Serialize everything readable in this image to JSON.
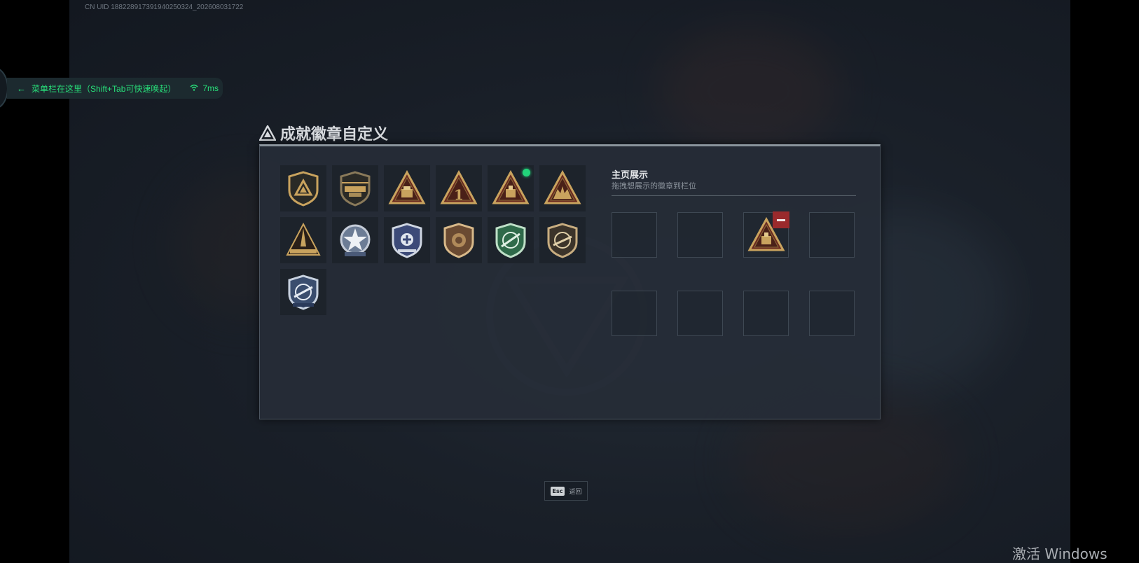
{
  "uid_text": "CN UID 1882289173919402503​24_202608031722",
  "menu_bar": {
    "hint": "菜单栏在这里（Shift+Tab可快速唤起）",
    "ping": "7ms"
  },
  "panel": {
    "title": "成就徽章自定义"
  },
  "badges": [
    {
      "icon": "triangle-shield-badge-icon",
      "new": false
    },
    {
      "icon": "helicopter-badge-icon",
      "new": false
    },
    {
      "icon": "vehicle-triangle-badge-icon",
      "new": false
    },
    {
      "icon": "number-one-badge-icon",
      "new": false
    },
    {
      "icon": "crate-triangle-badge-icon",
      "new": true
    },
    {
      "icon": "soldiers-triangle-badge-icon",
      "new": false
    },
    {
      "icon": "rocket-triangle-badge-icon",
      "new": false
    },
    {
      "icon": "star-emblem-badge-icon",
      "new": false
    },
    {
      "icon": "police-shield-badge-icon",
      "new": false
    },
    {
      "icon": "lion-shield-badge-icon",
      "new": false
    },
    {
      "icon": "green-rifle-shield-badge-icon",
      "new": false
    },
    {
      "icon": "rifle-shield-badge-icon",
      "new": false
    },
    {
      "icon": "blue-rifle-shield-badge-icon",
      "new": false
    }
  ],
  "showcase": {
    "title": "主页展示",
    "subtitle": "拖拽想展示的徽章到栏位",
    "slots": [
      "",
      "",
      "crate-triangle-badge-icon",
      "",
      "",
      "",
      "",
      ""
    ]
  },
  "footer": {
    "esc_key": "Esc",
    "esc_label": "返回"
  },
  "watermark": "激活 Windows",
  "colors": {
    "accent_green": "#28e07a",
    "badge_gold": "#c9a35e",
    "remove_red": "#9a2a2c"
  }
}
